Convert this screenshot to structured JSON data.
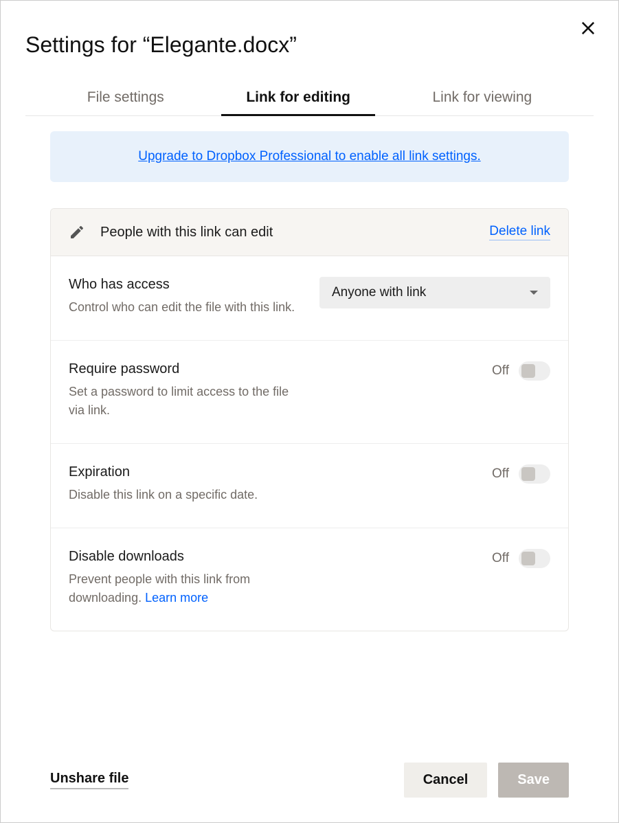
{
  "title": "Settings for “Elegante.docx”",
  "tabs": {
    "file_settings": "File settings",
    "link_editing": "Link for editing",
    "link_viewing": "Link for viewing"
  },
  "banner": {
    "text": "Upgrade to Dropbox Professional to enable all link settings."
  },
  "card": {
    "header_text": "People with this link can edit",
    "delete_link": "Delete link"
  },
  "settings": {
    "access": {
      "title": "Who has access",
      "desc": "Control who can edit the file with this link.",
      "dropdown_value": "Anyone with link"
    },
    "password": {
      "title": "Require password",
      "desc": "Set a password to limit access to the file via link.",
      "state": "Off"
    },
    "expiration": {
      "title": "Expiration",
      "desc": "Disable this link on a specific date.",
      "state": "Off"
    },
    "downloads": {
      "title": "Disable downloads",
      "desc_prefix": "Prevent people with this link from downloading. ",
      "learn_more": "Learn more",
      "state": "Off"
    }
  },
  "footer": {
    "unshare": "Unshare file",
    "cancel": "Cancel",
    "save": "Save"
  }
}
